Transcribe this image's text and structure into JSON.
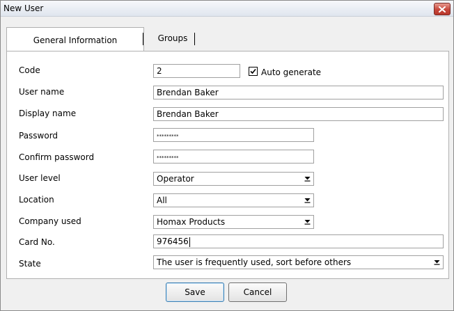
{
  "window": {
    "title": "New User"
  },
  "tabs": [
    {
      "label": "General Information",
      "active": true
    },
    {
      "label": "Groups",
      "active": false
    }
  ],
  "form": {
    "code": {
      "label": "Code",
      "value": "2"
    },
    "auto_generate": {
      "label": "Auto generate",
      "checked": true
    },
    "user_name": {
      "label": "User name",
      "value": "Brendan Baker"
    },
    "display_name": {
      "label": "Display name",
      "value": "Brendan Baker"
    },
    "password": {
      "label": "Password",
      "value": "*********"
    },
    "confirm_password": {
      "label": "Confirm password",
      "value": "*********"
    },
    "user_level": {
      "label": "User level",
      "value": "Operator"
    },
    "location": {
      "label": "Location",
      "value": "All"
    },
    "company_used": {
      "label": "Company used",
      "value": "Homax Products"
    },
    "card_no": {
      "label": "Card No.",
      "value": "976456"
    },
    "state": {
      "label": "State",
      "value": "The user is frequently used, sort before others"
    }
  },
  "buttons": {
    "save": "Save",
    "cancel": "Cancel"
  },
  "icons": {
    "close": "close-icon",
    "dropdown": "chevron-down-icon",
    "check": "checkmark-icon"
  },
  "colors": {
    "close_button": "#c7473b",
    "panel_bg": "#ffffff",
    "window_bg": "#f0f0f0"
  }
}
